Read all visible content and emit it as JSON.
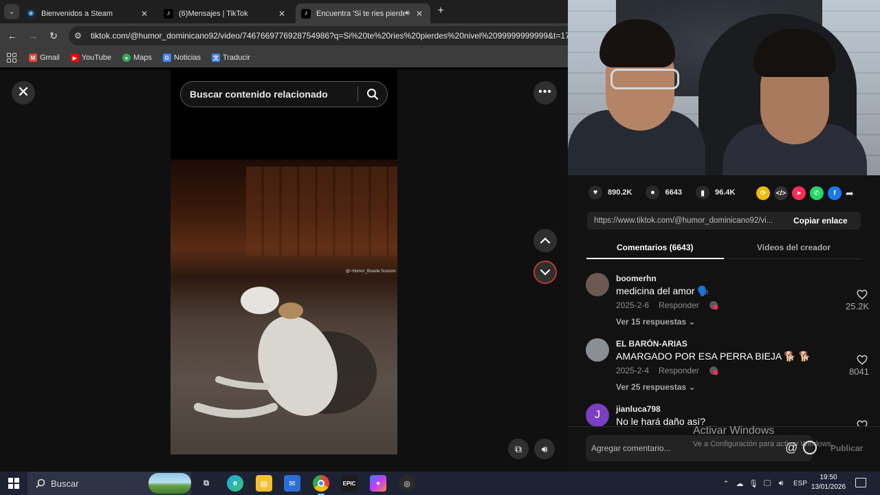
{
  "browser": {
    "tabs": [
      {
        "title": "Bienvenidos a Steam",
        "favicon": "steam-icon",
        "active": false
      },
      {
        "title": "(6)Mensajes | TikTok",
        "favicon": "tiktok-icon",
        "active": false
      },
      {
        "title": "Encuentra 'Si te ries pierdes",
        "favicon": "tiktok-icon",
        "active": true
      }
    ],
    "tab_close": "✕",
    "new_tab": "+",
    "url": "tiktok.com/@humor_dominicano92/video/7467669776928754986?q=Si%20te%20ries%20pierdes%20nivel%2099999999999&t=1768351",
    "bookmarks": [
      {
        "label": "Gmail",
        "icon": "gmail-icon",
        "color": "#ea4335",
        "glyph": "M"
      },
      {
        "label": "YouTube",
        "icon": "youtube-icon",
        "color": "#ff0000",
        "glyph": "▶"
      },
      {
        "label": "Maps",
        "icon": "maps-icon",
        "color": "#34a853",
        "glyph": "●"
      },
      {
        "label": "Noticias",
        "icon": "news-icon",
        "color": "#4285f4",
        "glyph": "G"
      },
      {
        "label": "Traducir",
        "icon": "translate-icon",
        "color": "#4285f4",
        "glyph": "文"
      }
    ]
  },
  "player": {
    "search_placeholder": "Buscar contenido relacionado",
    "watermark": "@~Humor_Brasile Scoosm"
  },
  "panel": {
    "likes": "890.2K",
    "comments_count": "6643",
    "saves": "96.4K",
    "share_url": "https://www.tiktok.com/@humor_dominicano92/vi...",
    "copy_label": "Copiar enlace",
    "tab_comments": "Comentarios (6643)",
    "tab_creator": "Videos del creador",
    "comments": [
      {
        "user": "boomerhn",
        "text": "medicina del amor 🗣️",
        "date": "2025-2-6",
        "reply": "Responder",
        "replies": "Ver 15 respuestas ⌄",
        "likes": "25.2K",
        "avatar_color": "#6b5a52"
      },
      {
        "user": "EL BARÓN-ARIAS",
        "text": "AMARGADO POR ESA PERRA BIEJA 🐕 🐕",
        "date": "2025-2-4",
        "reply": "Responder",
        "replies": "Ver 25 respuestas ⌄",
        "likes": "8041",
        "avatar_color": "#8a8f96"
      },
      {
        "user": "jianluca798",
        "text": "No le hará daño así?",
        "date": "",
        "reply": "",
        "replies": "",
        "likes": "",
        "avatar_color": "#7a3fc2",
        "avatar_letter": "J"
      }
    ],
    "comment_placeholder": "Agregar comentario...",
    "at": "@",
    "post_label": "Publicar"
  },
  "windows": {
    "activate_title": "Activar Windows",
    "activate_sub": "Ve a Configuración para activar Windows.",
    "search_placeholder": "Buscar",
    "lang": "ESP",
    "time": "19:50",
    "date": "13/01/2026"
  },
  "colors": {
    "accent_red": "#fe2c55",
    "tiktok_bg": "#121212",
    "taskbar": "#1d2333"
  }
}
